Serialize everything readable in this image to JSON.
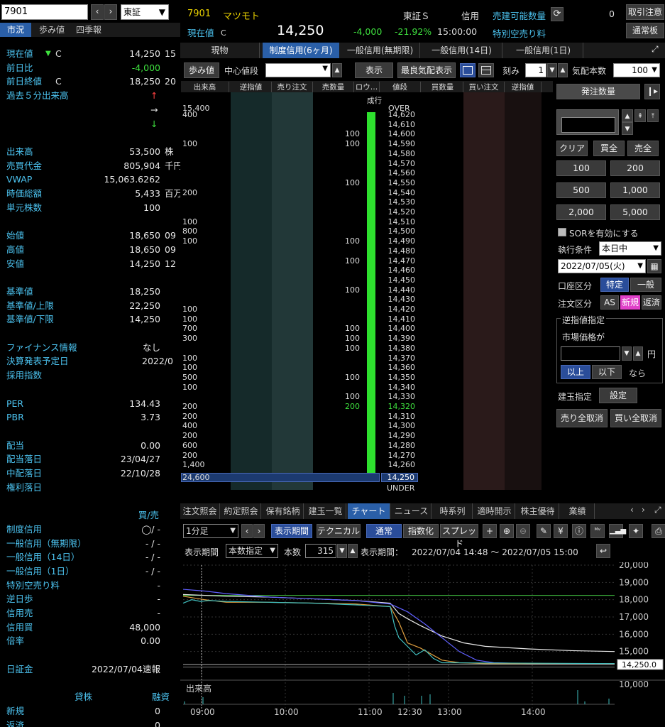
{
  "top": {
    "code": "7901",
    "market": "東証",
    "code_label": "7901",
    "name": "マツモト",
    "price_label": "現在値",
    "c_mark": "C",
    "price": "14,250",
    "exchange": "東証Ｓ",
    "credit": "信用",
    "change": "-4,000",
    "change_pct": "-21.92%",
    "time": "15:00:00",
    "sell_qty_label": "売建可能数量",
    "special_label": "特別空売り料",
    "sell_qty": "0",
    "btn_caution": "取引注意",
    "btn_normal": "通常板"
  },
  "left_tabs": [
    "市況",
    "歩み値",
    "四季報"
  ],
  "left": {
    "rows": [
      {
        "k": "現在値",
        "mark": "▼",
        "c": "C",
        "v": "14,250",
        "u": "15"
      },
      {
        "k": "前日比",
        "v": "-4,000",
        "green": true
      },
      {
        "k": "前日終値",
        "c": "C",
        "v": "18,250",
        "u": "20"
      },
      {
        "k": "過去５分出来高",
        "arrow": "↑"
      },
      {
        "arrow": "→"
      },
      {
        "arrow": "↓"
      },
      {},
      {
        "k": "出来高",
        "v": "53,500",
        "u": "株"
      },
      {
        "k": "売買代金",
        "v": "805,904",
        "u": "千円"
      },
      {
        "k": "VWAP",
        "v": "15,063.6262"
      },
      {
        "k": "時価総額",
        "v": "5,433",
        "u": "百万"
      },
      {
        "k": "単元株数",
        "v": "100"
      },
      {},
      {
        "k": "始値",
        "v": "18,650",
        "u": "09"
      },
      {
        "k": "高値",
        "v": "18,650",
        "u": "09"
      },
      {
        "k": "安値",
        "v": "14,250",
        "u": "12"
      },
      {},
      {
        "k": "基準値",
        "v": "18,250"
      },
      {
        "k": "基準値/上限",
        "v": "22,250"
      },
      {
        "k": "基準値/下限",
        "v": "14,250"
      },
      {},
      {
        "k": "ファイナンス情報",
        "v": "なし"
      },
      {
        "k": "決算発表予定日",
        "v2": "2022/0"
      },
      {
        "k": "採用指数"
      },
      {},
      {
        "k": "PER",
        "v": "134.43"
      },
      {
        "k": "PBR",
        "v": "3.73"
      },
      {},
      {
        "k": "配当",
        "v": "0.00"
      },
      {
        "k": "配当落日",
        "v": "23/04/27"
      },
      {
        "k": "中配落日",
        "v": "22/10/28"
      },
      {
        "k": "権利落日"
      },
      {},
      {
        "v": "買/売",
        "k_blue_right": true
      },
      {
        "k": "制度信用",
        "v": "◯/ -"
      },
      {
        "k": "一般信用（無期限）",
        "v": "- / -"
      },
      {
        "k": "一般信用（14日）",
        "v": "- / -"
      },
      {
        "k": "一般信用（1日）",
        "v": "- / -"
      },
      {
        "k": "特別空売り料",
        "v": "-"
      },
      {
        "k": "逆日歩",
        "v": "-"
      },
      {
        "k": "信用売",
        "v": "-"
      },
      {
        "k": "信用買",
        "v": "48,000"
      },
      {
        "k": "倍率",
        "v": "0.00"
      },
      {},
      {
        "k": "日証金",
        "v": "2022/07/04速報"
      },
      {},
      {
        "k": "",
        "v": "貸株",
        "u": "融資",
        "hdr": true
      },
      {
        "k": "新規",
        "v": "0"
      },
      {
        "k": "返済",
        "v": "0"
      }
    ]
  },
  "credit_tabs": [
    "現物",
    "制度信用(6ヶ月)",
    "一般信用(無期限)",
    "一般信用(14日)",
    "一般信用(1日)"
  ],
  "board_toolbar": {
    "ayumi": "歩み値",
    "center_label": "中心値段",
    "show": "表示",
    "best": "最良気配表示",
    "tick_label": "刻み",
    "tick": "1",
    "depth_label": "気配本数",
    "depth": "100"
  },
  "board": {
    "headers": [
      "出来高",
      "逆指値",
      "売り注文",
      "売数量",
      "ロウ…",
      "値段",
      "買数量",
      "買い注文",
      "逆指値"
    ],
    "market_order": "成行",
    "over": "OVER",
    "over_vol": "15,400",
    "under": "UNDER",
    "total_vol": "24,600",
    "last_price": "14,250",
    "rows": [
      {
        "p": "14,620",
        "vol": "400"
      },
      {
        "p": "14,610"
      },
      {
        "p": "14,600",
        "sq": "100"
      },
      {
        "p": "14,590",
        "vol": "100",
        "sq": "100"
      },
      {
        "p": "14,580"
      },
      {
        "p": "14,570"
      },
      {
        "p": "14,560"
      },
      {
        "p": "14,550",
        "sq": "100"
      },
      {
        "p": "14,540",
        "vol": "200"
      },
      {
        "p": "14,530"
      },
      {
        "p": "14,520"
      },
      {
        "p": "14,510",
        "vol": "100"
      },
      {
        "p": "14,500",
        "vol": "800"
      },
      {
        "p": "14,490",
        "vol": "100",
        "sq": "100"
      },
      {
        "p": "14,480"
      },
      {
        "p": "14,470",
        "sq": "100"
      },
      {
        "p": "14,460"
      },
      {
        "p": "14,450"
      },
      {
        "p": "14,440",
        "sq": "100"
      },
      {
        "p": "14,430"
      },
      {
        "p": "14,420",
        "vol": "100"
      },
      {
        "p": "14,410",
        "vol": "100"
      },
      {
        "p": "14,400",
        "vol": "700",
        "sq": "100"
      },
      {
        "p": "14,390",
        "vol": "300",
        "sq": "100"
      },
      {
        "p": "14,380",
        "sq": "100"
      },
      {
        "p": "14,370",
        "vol": "100"
      },
      {
        "p": "14,360",
        "vol": "100"
      },
      {
        "p": "14,350",
        "vol": "500",
        "sq": "100"
      },
      {
        "p": "14,340",
        "vol": "100"
      },
      {
        "p": "14,330",
        "sq": "100"
      },
      {
        "p": "14,320",
        "vol": "200",
        "sq": "200",
        "hl": true
      },
      {
        "p": "14,310",
        "vol": "200"
      },
      {
        "p": "14,300",
        "vol": "400"
      },
      {
        "p": "14,290",
        "vol": "200"
      },
      {
        "p": "14,280",
        "vol": "600"
      },
      {
        "p": "14,270",
        "vol": "200"
      },
      {
        "p": "14,260",
        "vol": "1,400"
      }
    ]
  },
  "order": {
    "qty_label": "発注数量",
    "clear": "クリア",
    "buy_all": "買全",
    "sell_all": "売全",
    "qty_buttons": [
      "100",
      "200",
      "500",
      "1,000",
      "2,000",
      "5,000"
    ],
    "sor": "SORを有効にする",
    "cond_label": "執行条件",
    "cond": "本日中",
    "date": "2022/07/05(火)",
    "acct_label": "口座区分",
    "acct1": "特定",
    "acct2": "一般",
    "order_label": "注文区分",
    "as": "AS",
    "new": "新規",
    "close": "返済",
    "stop_title": "逆指値指定",
    "market_price": "市場価格が",
    "yen": "円",
    "above": "以上",
    "below": "以下",
    "nara": "なら",
    "pos_label": "建玉指定",
    "set": "設定",
    "cancel_sell": "売り全取消",
    "cancel_buy": "買い全取消"
  },
  "bottom_tabs": [
    "注文照会",
    "約定照会",
    "保有銘柄",
    "建玉一覧",
    "チャート",
    "ニュース",
    "時系列",
    "適時開示",
    "株主優待",
    "業績"
  ],
  "chart_toolbar": {
    "interval": "1分足",
    "period_btn": "表示期間",
    "tech": "テクニカル",
    "normal": "通常",
    "index": "指数化",
    "spread": "スプレッド",
    "period_label": "表示期間",
    "mode": "本数指定",
    "count_label": "本数",
    "count": "315",
    "range_label": "表示期間：",
    "range": "2022/07/04 14:48 ～ 2022/07/05 15:00"
  },
  "chart_data": {
    "type": "line",
    "title": "",
    "xlabel": "",
    "ylabel": "",
    "xticks": [
      "09:00",
      "10:00",
      "11:00",
      "12:30",
      "13:00",
      "14:00"
    ],
    "yticks": [
      20000,
      19000,
      18000,
      17000,
      16000,
      15000,
      14250,
      10000
    ],
    "ytick_labels": [
      "20,000",
      "19,000",
      "18,000",
      "17,000",
      "16,000",
      "15,000",
      "14,250.0",
      "10,000"
    ],
    "ylim": [
      14000,
      20000
    ],
    "volume_label": "出来高",
    "series": [
      {
        "color": "#e8e8e8",
        "points": [
          [
            0,
            18300
          ],
          [
            5,
            18250
          ],
          [
            10,
            18200
          ],
          [
            20,
            18150
          ],
          [
            30,
            18050
          ],
          [
            40,
            17950
          ],
          [
            48,
            17800
          ],
          [
            50,
            17200
          ],
          [
            52,
            16900
          ],
          [
            55,
            16500
          ],
          [
            60,
            15900
          ],
          [
            65,
            15500
          ],
          [
            70,
            15300
          ],
          [
            80,
            15150
          ],
          [
            90,
            15050
          ],
          [
            100,
            15000
          ]
        ]
      },
      {
        "color": "#6060ff",
        "points": [
          [
            0,
            18600
          ],
          [
            5,
            18500
          ],
          [
            10,
            18350
          ],
          [
            20,
            18150
          ],
          [
            30,
            18050
          ],
          [
            40,
            17950
          ],
          [
            48,
            17750
          ],
          [
            52,
            17300
          ],
          [
            56,
            16600
          ],
          [
            60,
            15800
          ],
          [
            64,
            15000
          ],
          [
            68,
            14500
          ],
          [
            72,
            14350
          ],
          [
            80,
            14300
          ],
          [
            100,
            14300
          ]
        ]
      },
      {
        "color": "#e0a040",
        "points": [
          [
            0,
            18200
          ],
          [
            5,
            18000
          ],
          [
            10,
            17850
          ],
          [
            20,
            17850
          ],
          [
            30,
            17800
          ],
          [
            40,
            17750
          ],
          [
            48,
            17600
          ],
          [
            50,
            16700
          ],
          [
            52,
            15500
          ],
          [
            55,
            15200
          ],
          [
            60,
            14500
          ],
          [
            64,
            14350
          ],
          [
            70,
            14300
          ],
          [
            100,
            14300
          ]
        ]
      },
      {
        "color": "#40c0c0",
        "points": [
          [
            0,
            17800
          ],
          [
            2,
            18000
          ],
          [
            4,
            17900
          ],
          [
            6,
            17950
          ],
          [
            10,
            17900
          ],
          [
            20,
            17850
          ],
          [
            30,
            17800
          ],
          [
            40,
            17700
          ],
          [
            48,
            17600
          ],
          [
            49,
            16500
          ],
          [
            50,
            15800
          ],
          [
            52,
            15300
          ],
          [
            54,
            14800
          ],
          [
            56,
            15100
          ],
          [
            58,
            14600
          ],
          [
            60,
            14350
          ],
          [
            100,
            14300
          ]
        ]
      }
    ],
    "ref_line": {
      "color": "#40c040",
      "value": 18250
    }
  }
}
